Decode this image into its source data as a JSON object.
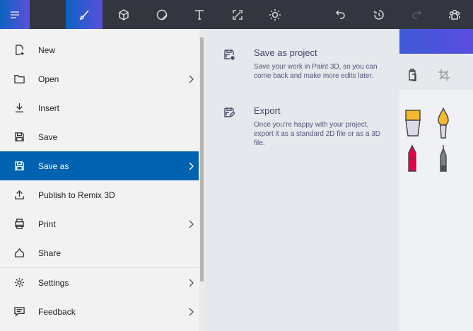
{
  "toolbar": {
    "icons": [
      "menu-icon",
      "brushes-icon",
      "3d-shapes-icon",
      "stickers-icon",
      "text-icon",
      "canvas-icon",
      "effects-icon",
      "undo-icon",
      "history-icon",
      "redo-icon",
      "community-icon"
    ]
  },
  "menu": {
    "items": [
      {
        "label": "New",
        "icon": "new-file-icon"
      },
      {
        "label": "Open",
        "icon": "folder-icon",
        "chevron": true
      },
      {
        "label": "Insert",
        "icon": "insert-icon"
      },
      {
        "label": "Save",
        "icon": "save-icon"
      },
      {
        "label": "Save as",
        "icon": "save-as-icon",
        "chevron": true,
        "selected": true
      },
      {
        "label": "Publish to Remix 3D",
        "icon": "upload-icon"
      },
      {
        "label": "Print",
        "icon": "print-icon",
        "chevron": true
      },
      {
        "label": "Share",
        "icon": "share-icon"
      },
      {
        "label": "Settings",
        "icon": "gear-icon",
        "chevron": true
      },
      {
        "label": "Feedback",
        "icon": "feedback-icon",
        "chevron": true
      }
    ]
  },
  "saveas": {
    "project": {
      "title": "Save as project",
      "desc": "Save your work in Paint 3D, so you can come back and make more edits later."
    },
    "export": {
      "title": "Export",
      "desc": "Once you’re happy with your project, export it as a standard 2D file or as a 3D file."
    }
  },
  "colors": {
    "accent": "#0063b1",
    "topbar": "#33363f"
  }
}
